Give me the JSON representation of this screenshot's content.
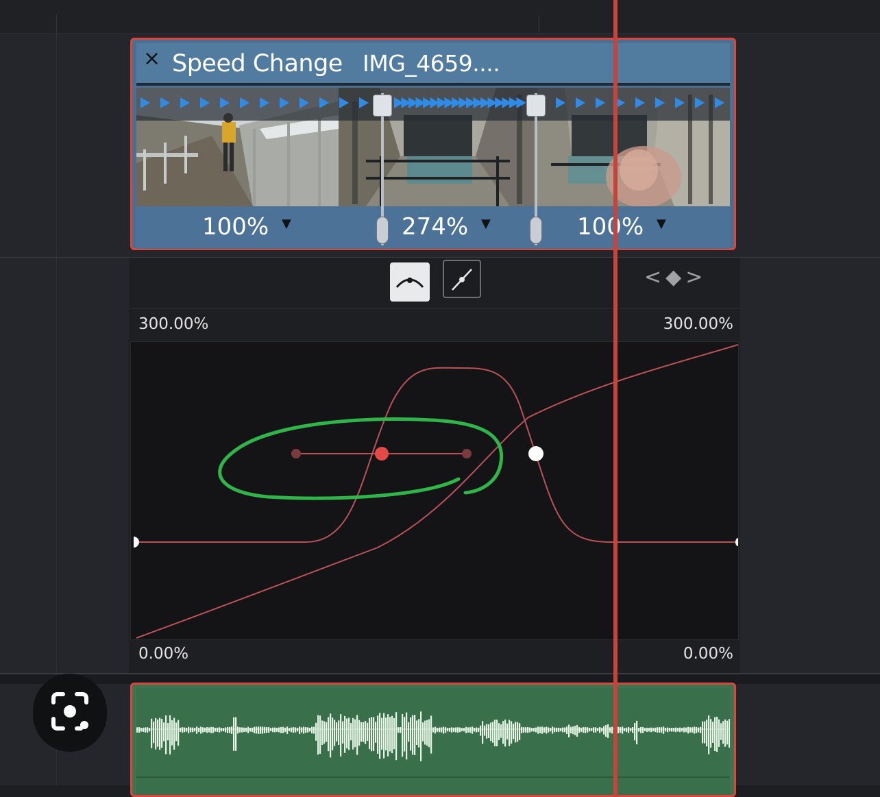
{
  "clip": {
    "close_glyph": "×",
    "title": "Speed Change",
    "filename": "IMG_4659....",
    "segments": [
      {
        "speed": "100%"
      },
      {
        "speed": "274%"
      },
      {
        "speed": "100%"
      }
    ],
    "dropdown_glyph": "▼",
    "arrow_color": "#2f8be6"
  },
  "curve_panel": {
    "keyframe_nav": "<◆>",
    "y_max_left": "300.00%",
    "y_max_right": "300.00%",
    "y_min_left": "0.00%",
    "y_min_right": "0.00%",
    "curve_color": "#b9525a",
    "keyframe_selected_color": "#e24b45",
    "annotation_color": "#2fb54a"
  },
  "audio": {
    "waveform_color": "#e6f5e6"
  },
  "colors": {
    "clip_border": "#d9473d",
    "playhead": "#c5443c",
    "clip_blue": "#527ba0",
    "audio_green": "#3f7450"
  }
}
